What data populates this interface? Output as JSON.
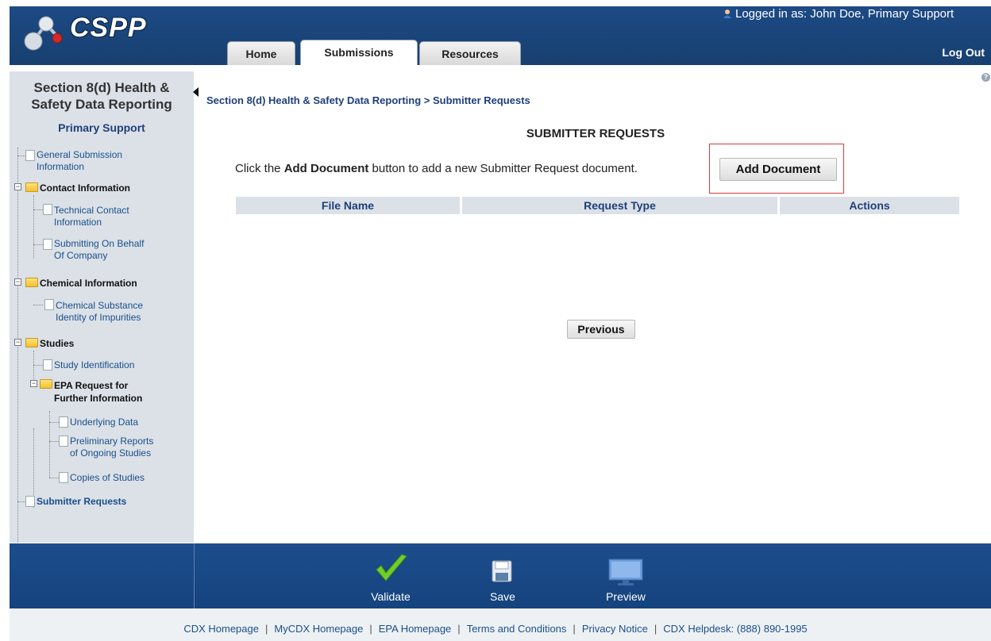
{
  "header": {
    "logo": "CSPP",
    "logged_in_prefix": "Logged in as: ",
    "logged_in_user": "John Doe, Primary Support",
    "logout": "Log Out",
    "tabs": [
      {
        "label": "Home",
        "active": false
      },
      {
        "label": "Submissions",
        "active": true
      },
      {
        "label": "Resources",
        "active": false
      }
    ]
  },
  "sidebar": {
    "title_line1": "Section 8(d) Health &",
    "title_line2": "Safety Data Reporting",
    "role": "Primary Support",
    "items": {
      "general_1": "General Submission",
      "general_2": "Information",
      "contact": "Contact Information",
      "technical_1": "Technical Contact",
      "technical_2": "Information",
      "behalf_1": "Submitting On Behalf",
      "behalf_2": "Of Company",
      "chemical": "Chemical Information",
      "substance_1": "Chemical Substance",
      "substance_2": "Identity of Impurities",
      "studies": "Studies",
      "study_id": "Study Identification",
      "epa_1": "EPA Request for",
      "epa_2": "Further Information",
      "underlying": "Underlying Data",
      "prelim_1": "Preliminary Reports",
      "prelim_2": "of Ongoing Studies",
      "copies": "Copies of Studies",
      "submitter": "Submitter Requests"
    }
  },
  "main": {
    "breadcrumb": "Section 8(d) Health & Safety Data Reporting > Submitter Requests",
    "title": "SUBMITTER REQUESTS",
    "instruction_pre": "Click the ",
    "instruction_bold": "Add Document",
    "instruction_post": " button to add a new Submitter Request document.",
    "add_button": "Add Document",
    "columns": [
      "File Name",
      "Request Type",
      "Actions"
    ],
    "previous_button": "Previous"
  },
  "footer": {
    "validate": "Validate",
    "save": "Save",
    "preview": "Preview",
    "links": [
      "CDX Homepage",
      "MyCDX Homepage",
      "EPA Homepage",
      "Terms and Conditions",
      "Privacy Notice",
      "CDX Helpdesk: (888) 890-1995"
    ]
  },
  "colors": {
    "banner": "#1d4a86",
    "sidebar_bg": "#dbe1e7",
    "link": "#1a4f8c",
    "highlight": "#d93a3a"
  }
}
